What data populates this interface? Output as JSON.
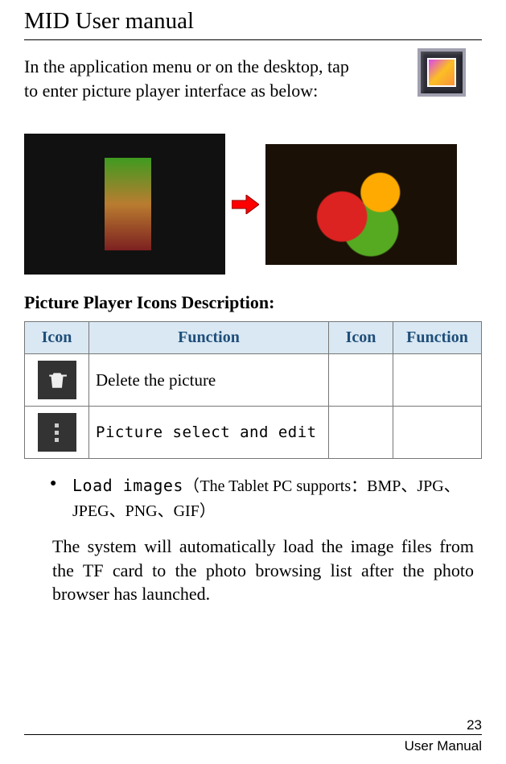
{
  "header": {
    "title": "MID User manual"
  },
  "intro": {
    "line1": "In the application menu or on the desktop, tap",
    "line2": "to enter picture player interface as below:"
  },
  "section_heading": "Picture Player Icons Description:",
  "table": {
    "headers": {
      "icon": "Icon",
      "function": "Function",
      "icon2": "Icon",
      "function2": "Function"
    },
    "rows": [
      {
        "func": "Delete the picture",
        "mono": false
      },
      {
        "func": "Picture select and edit",
        "mono": true
      }
    ]
  },
  "bullet": {
    "prefix": "Load images",
    "paren_open": "（",
    "mid": "The Tablet PC supports：",
    "formats": "BMP、JPG、JPEG、PNG、GIF",
    "paren_close": "）"
  },
  "body_para": "The system will automatically load the image files from the TF card to the photo browsing list after the photo browser has launched.",
  "footer": {
    "page": "23",
    "label": "User Manual"
  }
}
